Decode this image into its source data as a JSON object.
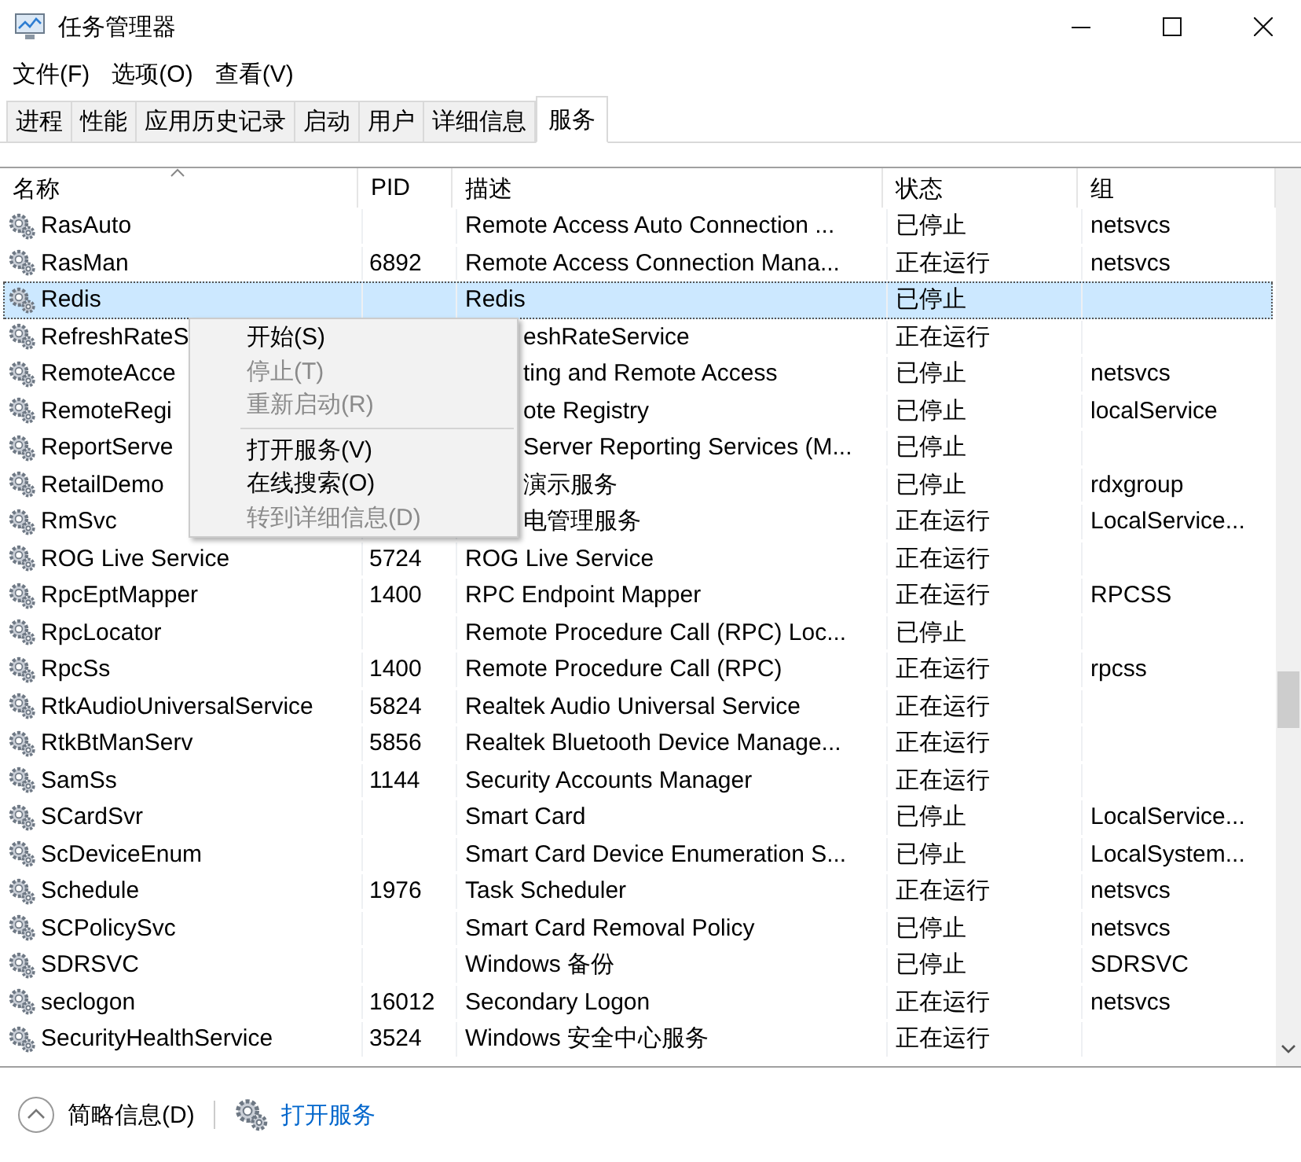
{
  "window": {
    "title": "任务管理器"
  },
  "menu_bar": [
    "文件(F)",
    "选项(O)",
    "查看(V)"
  ],
  "tabs": [
    {
      "label": "进程",
      "selected": false
    },
    {
      "label": "性能",
      "selected": false
    },
    {
      "label": "应用历史记录",
      "selected": false
    },
    {
      "label": "启动",
      "selected": false
    },
    {
      "label": "用户",
      "selected": false
    },
    {
      "label": "详细信息",
      "selected": false
    },
    {
      "label": "服务",
      "selected": true
    }
  ],
  "table": {
    "columns": [
      "名称",
      "PID",
      "描述",
      "状态",
      "组"
    ],
    "rows": [
      {
        "name": "RasAuto",
        "pid": "",
        "description": "Remote Access Auto Connection ...",
        "status": "已停止",
        "group": "netsvcs",
        "selected": false,
        "covered": false
      },
      {
        "name": "RasMan",
        "pid": "6892",
        "description": "Remote Access Connection Mana...",
        "status": "正在运行",
        "group": "netsvcs",
        "selected": false,
        "covered": false
      },
      {
        "name": "Redis",
        "pid": "",
        "description": "Redis",
        "status": "已停止",
        "group": "",
        "selected": true,
        "covered": false
      },
      {
        "name": "RefreshRateS",
        "pid": "",
        "description": "eshRateService",
        "status": "正在运行",
        "group": "",
        "selected": false,
        "covered": true
      },
      {
        "name": "RemoteAcce",
        "pid": "",
        "description": "ting and Remote Access",
        "status": "已停止",
        "group": "netsvcs",
        "selected": false,
        "covered": true
      },
      {
        "name": "RemoteRegi",
        "pid": "",
        "description": "ote Registry",
        "status": "已停止",
        "group": "localService",
        "selected": false,
        "covered": true
      },
      {
        "name": "ReportServe",
        "pid": "",
        "description": "Server Reporting Services (M...",
        "status": "已停止",
        "group": "",
        "selected": false,
        "covered": true
      },
      {
        "name": "RetailDemo",
        "pid": "",
        "description": "演示服务",
        "status": "已停止",
        "group": "rdxgroup",
        "selected": false,
        "covered": true
      },
      {
        "name": "RmSvc",
        "pid": "",
        "description": "电管理服务",
        "status": "正在运行",
        "group": "LocalService...",
        "selected": false,
        "covered": true
      },
      {
        "name": "ROG Live Service",
        "pid": "5724",
        "description": "ROG Live Service",
        "status": "正在运行",
        "group": "",
        "selected": false,
        "covered": false
      },
      {
        "name": "RpcEptMapper",
        "pid": "1400",
        "description": "RPC Endpoint Mapper",
        "status": "正在运行",
        "group": "RPCSS",
        "selected": false,
        "covered": false
      },
      {
        "name": "RpcLocator",
        "pid": "",
        "description": "Remote Procedure Call (RPC) Loc...",
        "status": "已停止",
        "group": "",
        "selected": false,
        "covered": false
      },
      {
        "name": "RpcSs",
        "pid": "1400",
        "description": "Remote Procedure Call (RPC)",
        "status": "正在运行",
        "group": "rpcss",
        "selected": false,
        "covered": false
      },
      {
        "name": "RtkAudioUniversalService",
        "pid": "5824",
        "description": "Realtek Audio Universal Service",
        "status": "正在运行",
        "group": "",
        "selected": false,
        "covered": false
      },
      {
        "name": "RtkBtManServ",
        "pid": "5856",
        "description": "Realtek Bluetooth Device Manage...",
        "status": "正在运行",
        "group": "",
        "selected": false,
        "covered": false
      },
      {
        "name": "SamSs",
        "pid": "1144",
        "description": "Security Accounts Manager",
        "status": "正在运行",
        "group": "",
        "selected": false,
        "covered": false
      },
      {
        "name": "SCardSvr",
        "pid": "",
        "description": "Smart Card",
        "status": "已停止",
        "group": "LocalService...",
        "selected": false,
        "covered": false
      },
      {
        "name": "ScDeviceEnum",
        "pid": "",
        "description": "Smart Card Device Enumeration S...",
        "status": "已停止",
        "group": "LocalSystem...",
        "selected": false,
        "covered": false
      },
      {
        "name": "Schedule",
        "pid": "1976",
        "description": "Task Scheduler",
        "status": "正在运行",
        "group": "netsvcs",
        "selected": false,
        "covered": false
      },
      {
        "name": "SCPolicySvc",
        "pid": "",
        "description": "Smart Card Removal Policy",
        "status": "已停止",
        "group": "netsvcs",
        "selected": false,
        "covered": false
      },
      {
        "name": "SDRSVC",
        "pid": "",
        "description": "Windows 备份",
        "status": "已停止",
        "group": "SDRSVC",
        "selected": false,
        "covered": false
      },
      {
        "name": "seclogon",
        "pid": "16012",
        "description": "Secondary Logon",
        "status": "正在运行",
        "group": "netsvcs",
        "selected": false,
        "covered": false
      },
      {
        "name": "SecurityHealthService",
        "pid": "3524",
        "description": "Windows 安全中心服务",
        "status": "正在运行",
        "group": "",
        "selected": false,
        "covered": false
      }
    ]
  },
  "context_menu": [
    {
      "kind": "item",
      "label": "开始(S)",
      "disabled": false
    },
    {
      "kind": "item",
      "label": "停止(T)",
      "disabled": true
    },
    {
      "kind": "item",
      "label": "重新启动(R)",
      "disabled": true
    },
    {
      "kind": "separator"
    },
    {
      "kind": "item",
      "label": "打开服务(V)",
      "disabled": false
    },
    {
      "kind": "item",
      "label": "在线搜索(O)",
      "disabled": false
    },
    {
      "kind": "item",
      "label": "转到详细信息(D)",
      "disabled": true
    }
  ],
  "footer": {
    "details_toggle": "简略信息(D)",
    "open_services_link": "打开服务"
  }
}
